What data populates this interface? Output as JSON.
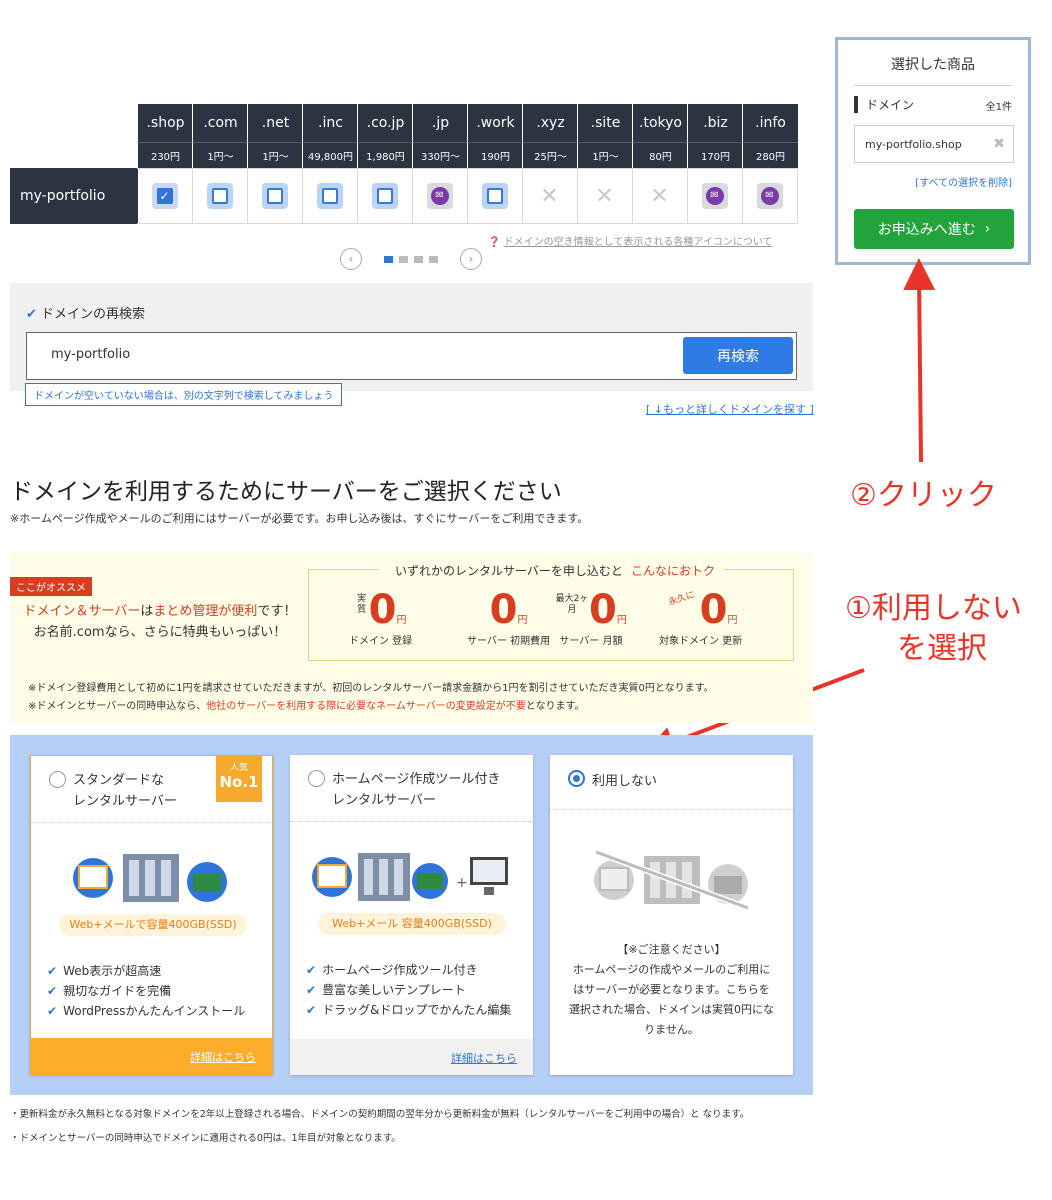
{
  "domain_table": {
    "search_word": "my-portfolio",
    "tlds": [
      {
        "name": ".shop",
        "price": "230円",
        "state": "checked"
      },
      {
        "name": ".com",
        "price": "1円〜",
        "state": "unchecked"
      },
      {
        "name": ".net",
        "price": "1円〜",
        "state": "unchecked"
      },
      {
        "name": ".inc",
        "price": "49,800円",
        "state": "unchecked"
      },
      {
        "name": ".co.jp",
        "price": "1,980円",
        "state": "unchecked"
      },
      {
        "name": ".jp",
        "price": "330円〜",
        "state": "mail"
      },
      {
        "name": ".work",
        "price": "190円",
        "state": "unchecked"
      },
      {
        "name": ".xyz",
        "price": "25円〜",
        "state": "unavailable"
      },
      {
        "name": ".site",
        "price": "1円〜",
        "state": "unavailable"
      },
      {
        "name": ".tokyo",
        "price": "80円",
        "state": "unavailable"
      },
      {
        "name": ".biz",
        "price": "170円",
        "state": "mail"
      },
      {
        "name": ".info",
        "price": "280円",
        "state": "mail"
      }
    ],
    "icon_note": "ドメインの空き情報として表示される各種アイコンについて",
    "pager_active": 0
  },
  "research": {
    "label": "ドメインの再検索",
    "input_value": "my-portfolio",
    "button": "再検索",
    "tooltip": "ドメインが空いていない場合は、別の文字列で検索してみましょう",
    "more_link": "[ ↓もっと詳しくドメインを探す ]"
  },
  "panel": {
    "title": "選択した商品",
    "section": "ドメイン",
    "count": "全1件",
    "item": "my-portfolio.shop",
    "clear_link": "[すべての選択を削除]",
    "proceed": "お申込みへ進む"
  },
  "annotations": {
    "click": "②クリック",
    "select_line1": "①利用しない",
    "select_line2": "を選択"
  },
  "server": {
    "heading": "ドメインを利用するためにサーバーをご選択ください",
    "sub": "※ホームページ作成やメールのご利用にはサーバーが必要です。お申し込み後は、すぐにサーバーをご利用できます。",
    "promo": {
      "tag": "ここがオススメ",
      "msg_a": "ドメイン＆サーバー",
      "msg_b": "は",
      "msg_c": "まとめ管理が便利",
      "msg_d": "です！",
      "msg_line2": "お名前.comなら、さらに特典もいっぱい！",
      "cap_a": "いずれかのレンタルサーバーを申し込むと",
      "cap_b": "こんなにおトク",
      "zeros": [
        {
          "pre": "実質",
          "value": "0",
          "unit": "円",
          "label": "ドメイン 登録"
        },
        {
          "pre": "",
          "value": "0",
          "unit": "円",
          "label": "サーバー 初期費用"
        },
        {
          "pre": "最大2ヶ月",
          "value": "0",
          "unit": "円",
          "label": "サーバー 月額"
        },
        {
          "pre": "永久に",
          "value": "0",
          "unit": "円",
          "label": "対象ドメイン 更新"
        }
      ],
      "note1": "※ドメイン登録費用として初めに1円を請求させていただきますが、初回のレンタルサーバー請求金額から1円を割引させていただき実質0円となります。",
      "note2_a": "※ドメインとサーバーの同時申込なら、",
      "note2_b": "他社のサーバーを利用する際に必要なネームサーバーの変更設定が不要",
      "note2_c": "となります。"
    },
    "plans": [
      {
        "title1": "スタンダードな",
        "title2": "レンタルサーバー",
        "badge_top": "人気",
        "badge": "No.1",
        "pill": "Web+メールで容量400GB(SSD)",
        "features": [
          "Web表示が超高速",
          "親切なガイドを完備",
          "WordPressかんたんインストール"
        ],
        "link": "詳細はこちら"
      },
      {
        "title1": "ホームページ作成ツール付き",
        "title2": "レンタルサーバー",
        "pill": "Web+メール 容量400GB(SSD)",
        "features": [
          "ホームページ作成ツール付き",
          "豊富な美しいテンプレート",
          "ドラッグ&ドロップでかんたん編集"
        ],
        "link": "詳細はこちら"
      },
      {
        "title1": "利用しない",
        "warn_title": "【※ご注意ください】",
        "warn": "ホームページの作成やメールのご利用にはサーバーが必要となります。こちらを選択された場合、ドメインは実質0円になりません。"
      }
    ],
    "footnote1": "・更新料金が永久無料となる対象ドメインを2年以上登録される場合、ドメインの契約期間の翌年分から更新料金が無料（レンタルサーバーをご利用中の場合）と なります。",
    "footnote2": "・ドメインとサーバーの同時申込でドメインに適用される0円は、1年目が対象となります。"
  },
  "colors": {
    "accent": "#2f74d9",
    "cta": "#22a33b",
    "red": "#e8352a",
    "header": "#2b3441"
  }
}
